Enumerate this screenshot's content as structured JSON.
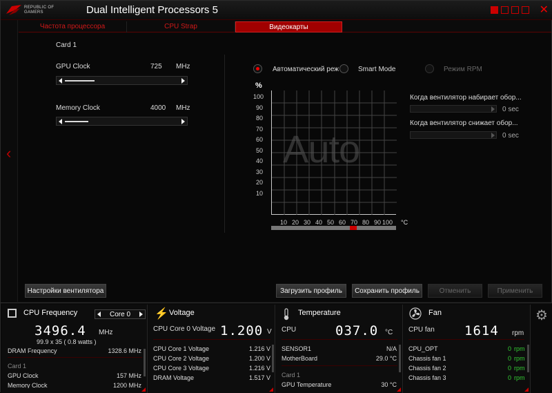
{
  "window": {
    "title": "Dual Intelligent Processors 5",
    "logo_line1": "REPUBLIC OF",
    "logo_line2": "GAMERS"
  },
  "tabs": [
    {
      "label": "Частота процессора"
    },
    {
      "label": "CPU Strap"
    },
    {
      "label": "Видеокарты",
      "active": true
    }
  ],
  "card": {
    "title": "Card 1",
    "gpu_clock": {
      "label": "GPU Clock",
      "value": "725",
      "unit": "MHz",
      "fraction": 0.25
    },
    "memory_clock": {
      "label": "Memory Clock",
      "value": "4000",
      "unit": "MHz",
      "fraction": 0.2
    }
  },
  "fan_modes": {
    "auto": "Автоматический режим",
    "smart": "Smart Mode",
    "rpm": "Режим RPM",
    "selected": "auto"
  },
  "fan_chart": {
    "y_unit": "%",
    "x_unit": "°C",
    "watermark": "Auto",
    "y_ticks": [
      "100",
      "90",
      "80",
      "70",
      "60",
      "50",
      "40",
      "30",
      "20",
      "10"
    ],
    "x_ticks": [
      "10",
      "20",
      "30",
      "40",
      "50",
      "60",
      "70",
      "80",
      "90",
      "100"
    ]
  },
  "fan_settings": {
    "ramp_up_label": "Когда вентилятор набирает обор...",
    "ramp_up_value": "0 sec",
    "ramp_down_label": "Когда вентилятор снижает обор...",
    "ramp_down_value": "0 sec"
  },
  "buttons": {
    "fan_settings": "Настройки вентилятора",
    "load_profile": "Загрузить профиль",
    "save_profile": "Сохранить профиль",
    "cancel": "Отменить",
    "apply": "Применить"
  },
  "monitor": {
    "cpu_freq": {
      "title": "CPU Frequency",
      "core_selector": "Core 0",
      "value": "3496.4",
      "unit": "MHz",
      "detail": "99.9  x 35  ( 0.8      watts )",
      "dram_label": "DRAM Frequency",
      "dram_value": "1328.6  MHz",
      "card_label": "Card 1",
      "gpu_clock_label": "GPU Clock",
      "gpu_clock_value": "157 MHz",
      "mem_clock_label": "Memory Clock",
      "mem_clock_value": "1200 MHz"
    },
    "voltage": {
      "title": "Voltage",
      "main_label": "CPU Core 0 Voltage",
      "main_value": "1.200",
      "main_unit": "V",
      "rows": [
        {
          "label": "CPU Core 1 Voltage",
          "value": "1.216  V"
        },
        {
          "label": "CPU Core 2 Voltage",
          "value": "1.200  V"
        },
        {
          "label": "CPU Core 3 Voltage",
          "value": "1.216  V"
        },
        {
          "label": "DRAM Voltage",
          "value": "1.517  V"
        }
      ]
    },
    "temperature": {
      "title": "Temperature",
      "main_label": "CPU",
      "main_value": "037.0",
      "main_unit": "°C",
      "rows": [
        {
          "label": "SENSOR1",
          "value": "N/A"
        },
        {
          "label": "MotherBoard",
          "value": "29.0 °C"
        }
      ],
      "card_label": "Card 1",
      "card_row_label": "GPU Temperature",
      "card_row_value": "30 °C"
    },
    "fan": {
      "title": "Fan",
      "main_label": "CPU fan",
      "main_value": "1614",
      "main_unit": "rpm",
      "rows": [
        {
          "label": "CPU_OPT",
          "value": "0",
          "unit": "rpm"
        },
        {
          "label": "Chassis fan 1",
          "value": "0",
          "unit": "rpm"
        },
        {
          "label": "Chassis fan 2",
          "value": "0",
          "unit": "rpm"
        },
        {
          "label": "Chassis fan 3",
          "value": "0",
          "unit": "rpm"
        }
      ]
    }
  },
  "colors": {
    "accent": "#c00000",
    "value_green": "#33cc33",
    "background": "#0b0b0b"
  }
}
